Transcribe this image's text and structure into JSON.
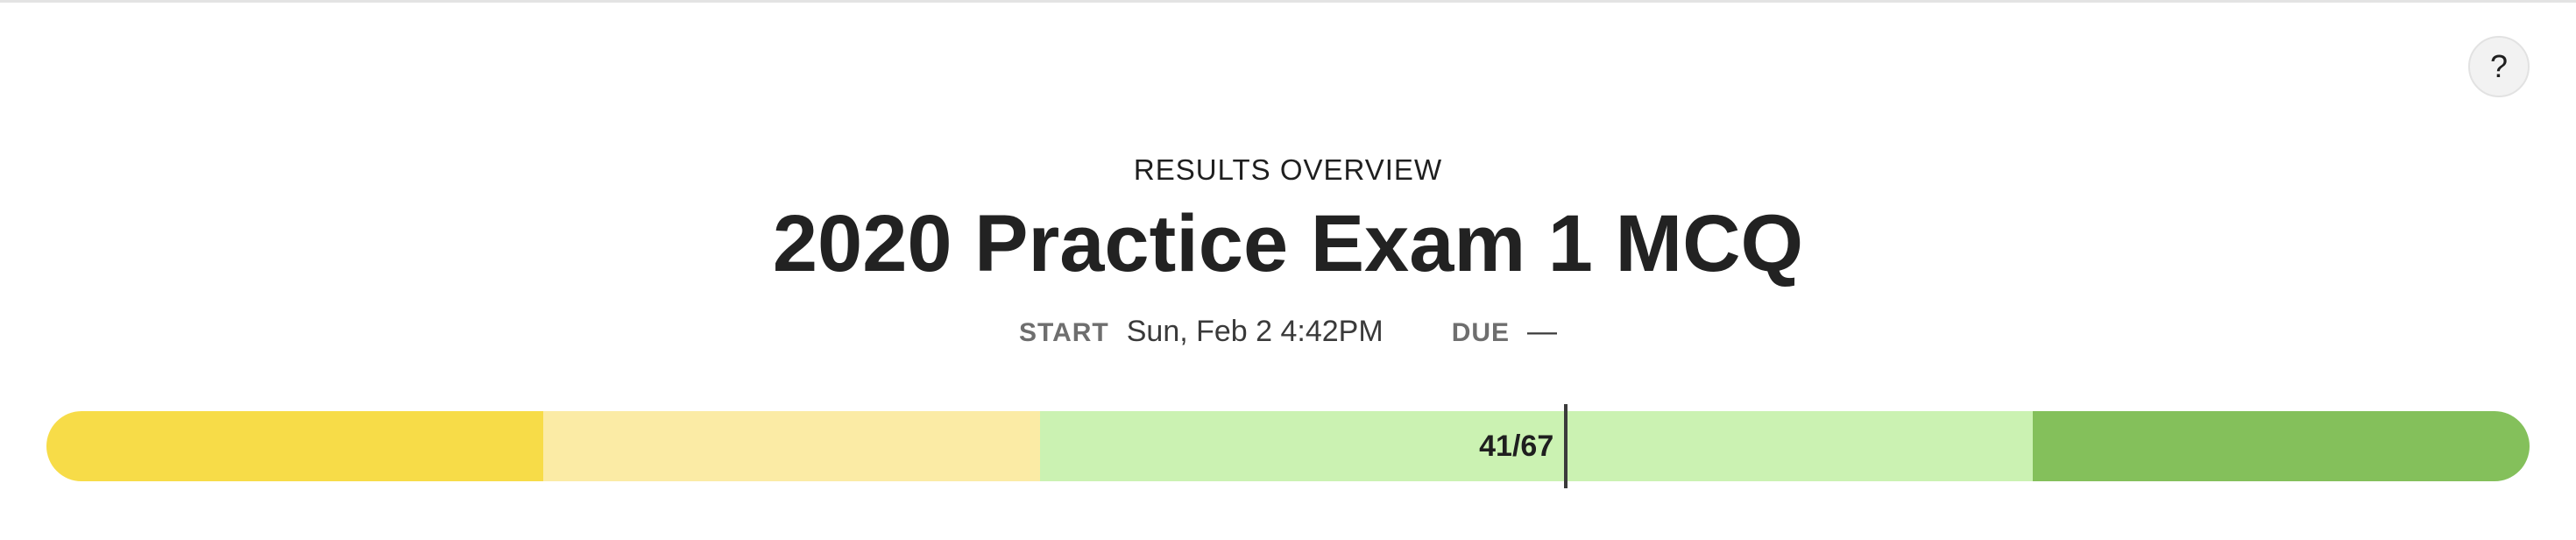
{
  "header": {
    "help_label": "?"
  },
  "overview": {
    "eyebrow": "RESULTS OVERVIEW",
    "title": "2020 Practice Exam 1 MCQ",
    "start_label": "START",
    "start_value": "Sun, Feb 2 4:42PM",
    "due_label": "DUE",
    "due_value": "—"
  },
  "score": {
    "label": "41/67",
    "correct": 41,
    "total": 67
  },
  "colors": {
    "band_1": "#f7dc48",
    "band_2": "#fbeba5",
    "band_3": "#cbf2b2",
    "band_4": "#cbf2b2",
    "band_5": "#84c05b",
    "marker": "#3b3b3b"
  }
}
